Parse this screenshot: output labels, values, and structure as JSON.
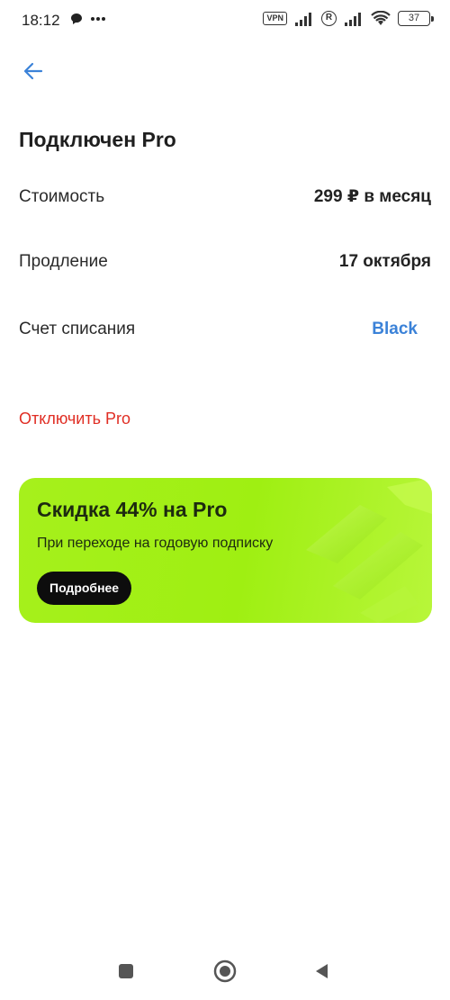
{
  "status_bar": {
    "time": "18:12",
    "vpn": "VPN",
    "roaming": "R",
    "battery": "37"
  },
  "header": {
    "title": "Подключен Pro"
  },
  "details": [
    {
      "label": "Стоимость",
      "value": "299 ₽ в месяц"
    },
    {
      "label": "Продление",
      "value": "17 октября"
    },
    {
      "label": "Счет списания",
      "value": "Black"
    }
  ],
  "actions": {
    "disable_label": "Отключить Pro"
  },
  "promo": {
    "title": "Скидка 44% на Pro",
    "subtitle": "При переходе на годовую подписку",
    "button_label": "Подробнее"
  },
  "colors": {
    "accent_blue": "#3b82d8",
    "danger_red": "#e02e24",
    "promo_green": "#a6f01c"
  },
  "icons": {
    "back": "arrow-left-icon",
    "nav_recent": "square-icon",
    "nav_home": "circle-icon",
    "nav_back": "triangle-back-icon"
  }
}
